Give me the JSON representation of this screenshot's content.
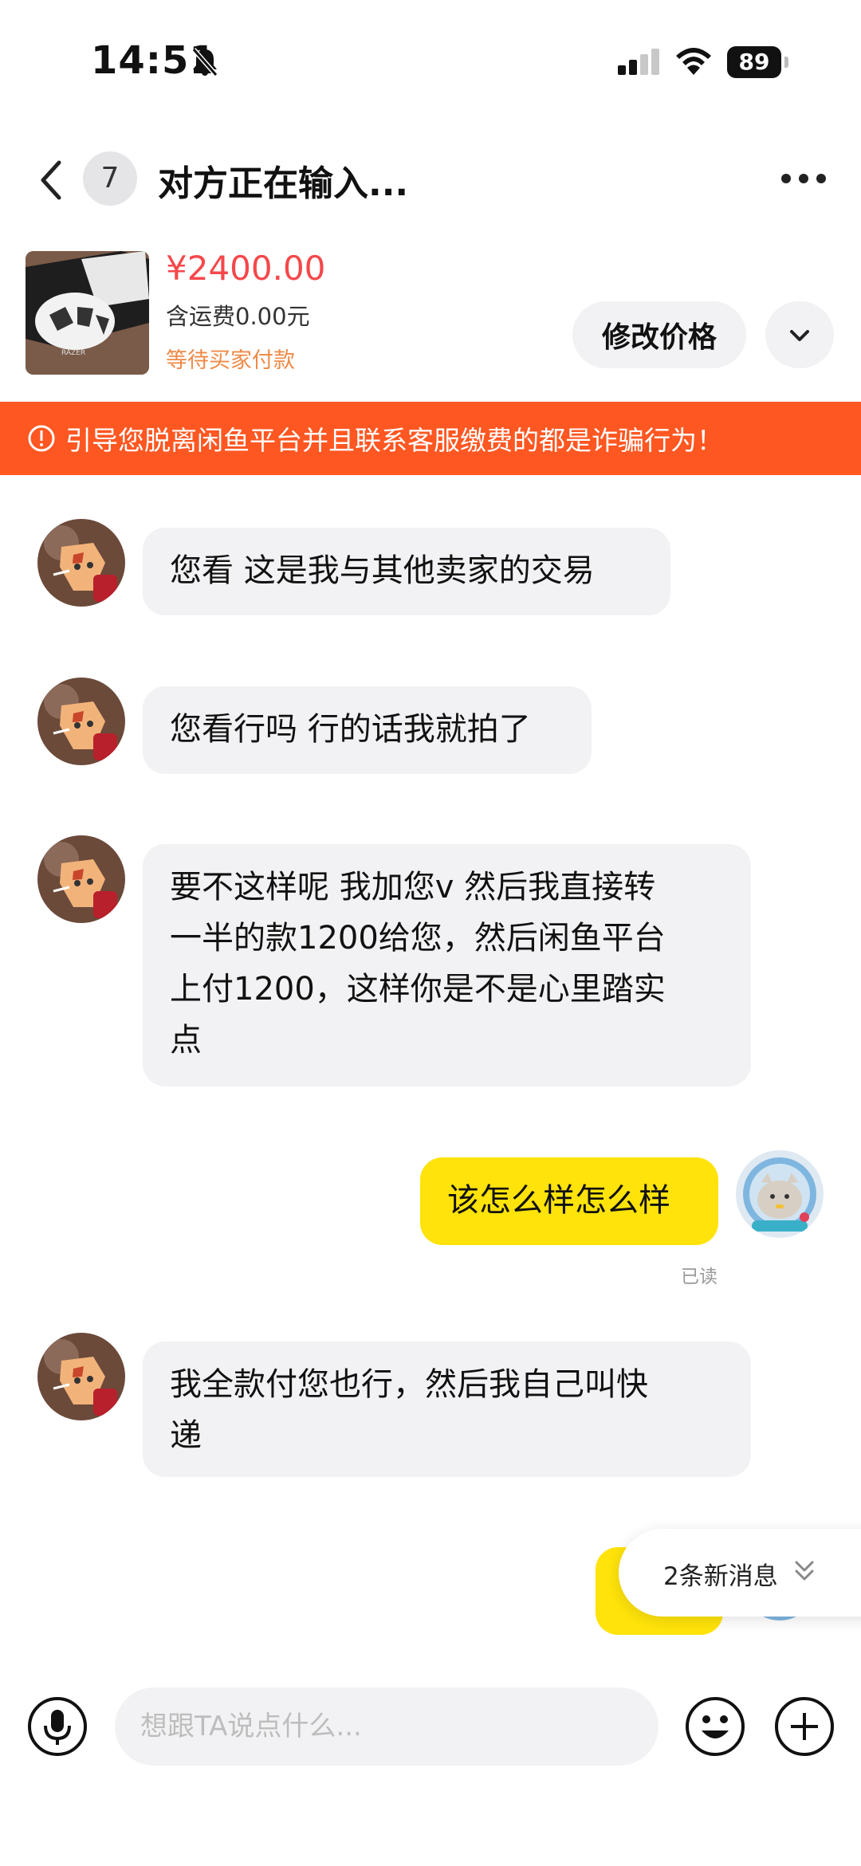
{
  "status_bar": {
    "time": "14:51",
    "battery": "89"
  },
  "nav": {
    "badge_count": "7",
    "title": "对方正在输入..."
  },
  "product": {
    "price": "¥2400.00",
    "shipping": "含运费0.00元",
    "status": "等待买家付款",
    "edit_price_label": "修改价格"
  },
  "warning": {
    "text": "引导您脱离闲鱼平台并且联系客服缴费的都是诈骗行为！"
  },
  "messages": [
    {
      "side": "in",
      "text": "您看 这是我与其他卖家的交易"
    },
    {
      "side": "in",
      "text": "您看行吗 行的话我就拍了"
    },
    {
      "side": "in",
      "lines": [
        "要不这样呢 我加您v 然后我直接转",
        "一半的款1200给您，然后闲鱼平台",
        "上付1200，这样你是不是心里踏实",
        "点"
      ]
    },
    {
      "side": "out",
      "text": "该怎么样怎么样",
      "read": "已读"
    },
    {
      "side": "in",
      "lines": [
        "我全款付您也行，然后我自己叫快",
        "递"
      ]
    }
  ],
  "new_messages": {
    "label": "2条新消息"
  },
  "input": {
    "placeholder": "想跟TA说点什么..."
  },
  "icons": [
    "bell-slash-icon",
    "signal-icon",
    "wifi-icon",
    "battery-icon",
    "back-icon",
    "more-icon",
    "chevron-down-icon",
    "warning-icon",
    "mic-icon",
    "emoji-icon",
    "plus-icon",
    "double-chevron-down-icon"
  ],
  "colors": {
    "price": "#f5484b",
    "warning_bg": "#ff5722",
    "out_bubble": "#ffe30a",
    "status_orange": "#f08a47"
  }
}
